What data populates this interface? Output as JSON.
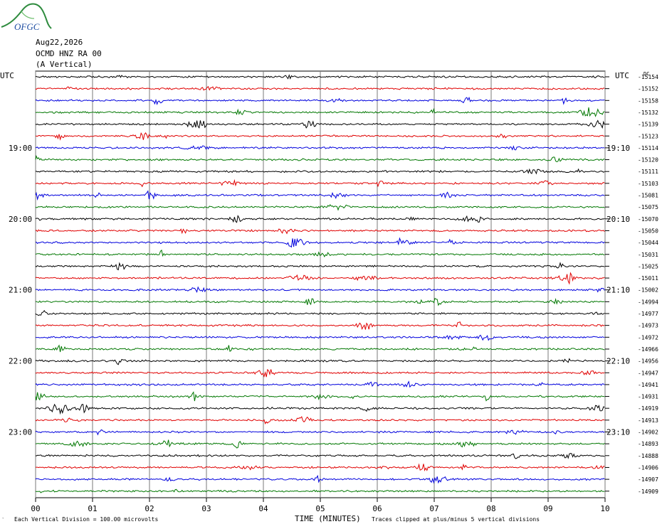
{
  "logo": {
    "text": "OFGC",
    "colors": {
      "mountain": "#2e8b3e",
      "text": "#1f4ea3"
    }
  },
  "header": {
    "date": "Aug22,2026",
    "station": "OCMD HNZ RA 00",
    "component": "(A Vertical)"
  },
  "chart_data": {
    "type": "line",
    "title": "",
    "left_axis_title": "UTC",
    "right_axis_title": "UTC",
    "right_unit_fragment": "DC",
    "xlabel": "TIME (MINUTES)",
    "footer_left": "Each Vertical Division =  100.00 microvolts",
    "footer_right": "Traces clipped at plus/minus 5 vertical divisions",
    "x_ticks": [
      "00",
      "01",
      "02",
      "03",
      "04",
      "05",
      "06",
      "07",
      "08",
      "09",
      "10"
    ],
    "xlim": [
      0,
      10
    ],
    "left_time_labels": [
      {
        "row": 6,
        "label": "19:00"
      },
      {
        "row": 12,
        "label": "20:00"
      },
      {
        "row": 18,
        "label": "21:00"
      },
      {
        "row": 24,
        "label": "22:00"
      },
      {
        "row": 30,
        "label": "23:00"
      }
    ],
    "right_time_labels": [
      {
        "row": 6,
        "label": "19:10"
      },
      {
        "row": 12,
        "label": "20:10"
      },
      {
        "row": 18,
        "label": "21:10"
      },
      {
        "row": 24,
        "label": "22:10"
      },
      {
        "row": 30,
        "label": "23:10"
      }
    ],
    "trace_colors": [
      "#000000",
      "#e00000",
      "#0000dd",
      "#007700"
    ],
    "dc_offsets": [
      "-15154",
      "-15152",
      "-15158",
      "-15132",
      "-15139",
      "-15123",
      "-15114",
      "-15120",
      "-15111",
      "-15103",
      "-15081",
      "-15075",
      "-15070",
      "-15050",
      "-15044",
      "-15031",
      "-15025",
      "-15011",
      "-15002",
      "-14994",
      "-14977",
      "-14973",
      "-14972",
      "-14966",
      "-14956",
      "-14947",
      "-14941",
      "-14931",
      "-14919",
      "-14913",
      "-14902",
      "-14893",
      "-14888",
      "-14906",
      "-14907",
      "-14909"
    ],
    "grid": true
  }
}
